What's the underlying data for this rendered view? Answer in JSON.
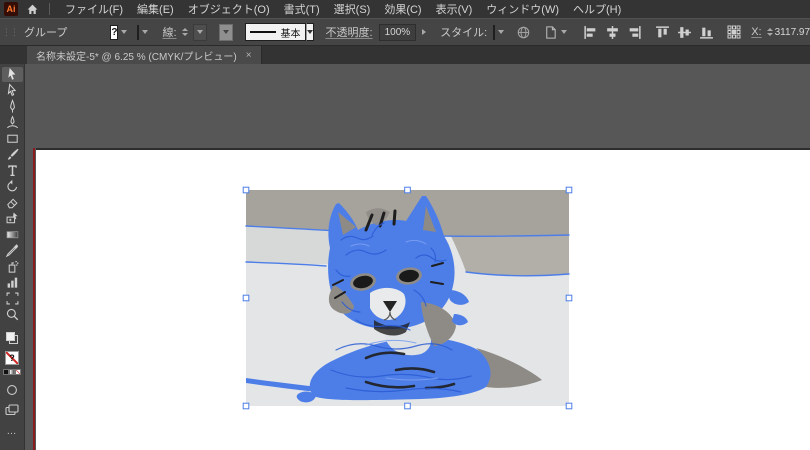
{
  "app": {
    "logo_text": "Ai"
  },
  "menu_bar": {
    "items": [
      "ファイル(F)",
      "編集(E)",
      "オブジェクト(O)",
      "書式(T)",
      "選択(S)",
      "効果(C)",
      "表示(V)",
      "ウィンドウ(W)",
      "ヘルプ(H)"
    ]
  },
  "control_bar": {
    "selection_type": "グループ",
    "fill_swatch_symbol": "?",
    "stroke_width_label": "線:",
    "brush_name": "基本",
    "opacity_label": "不透明度:",
    "opacity_value": "100%",
    "style_label": "スタイル:",
    "x_label": "X:",
    "x_value": "3117.97",
    "align_tools": [
      "horizontal-align-left",
      "horizontal-align-center",
      "horizontal-align-right",
      "vertical-align-top",
      "vertical-align-middle",
      "vertical-align-bottom"
    ]
  },
  "document_tab": {
    "title": "名称未設定-5* @ 6.25 % (CMYK/プレビュー)",
    "close_symbol": "×"
  },
  "toolbar": {
    "tools": [
      "selection",
      "direct-selection",
      "pen",
      "curvature",
      "rectangle",
      "paintbrush",
      "type",
      "rotate",
      "eraser",
      "shape-builder",
      "gradient",
      "eyedropper",
      "symbol-sprayer",
      "graph",
      "artboard",
      "zoom"
    ],
    "more_symbol": "…"
  },
  "canvas": {
    "description": "image-traced cat artwork selected on white artboard",
    "pasteboard_color": "#575757",
    "artboard_color": "#ffffff",
    "bleed_line_color": "#8a1a1d",
    "selection_blue": "#4d7ee8",
    "image": {
      "band_gray": "#a6a39d",
      "mid_gray": "#b2afa9",
      "left_band": "#d7d9d9",
      "light_bg": "#e3e5e7",
      "patch_gray": "#8e8b86",
      "dark": "#1e1e1e",
      "white_patch": "#e8eaec"
    }
  }
}
